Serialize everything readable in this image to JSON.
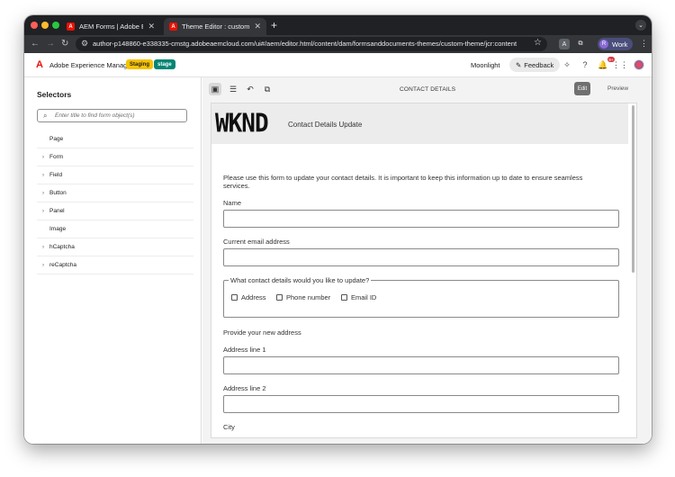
{
  "browser": {
    "tabs": [
      {
        "title": "AEM Forms | Adobe Experience",
        "favicon": "A",
        "active": false
      },
      {
        "title": "Theme Editor : custom-theme",
        "favicon": "A",
        "active": true
      }
    ],
    "new_tab": "+",
    "tab_menu": "⌄",
    "url": "author-p148860-e338335-cmstg.adobeaemcloud.com/ui#/aem/editor.html/content/dam/formsanddocuments-themes/custom-theme/jcr:content",
    "profile_label": "Work",
    "profile_initial": "R",
    "extension_1": "A",
    "traffic_colors": [
      "#ff5f57",
      "#febc2e",
      "#28c840"
    ]
  },
  "app_header": {
    "app_name": "Adobe Experience Manager",
    "badge_staging": "Staging",
    "badge_stage": "stage",
    "theme_label": "Moonlight",
    "feedback_label": "Feedback",
    "notification_count": "9+",
    "accent_color": "#eb1000"
  },
  "sidebar": {
    "title": "Selectors",
    "search_placeholder": "Enter title to find form object(s)",
    "items": [
      {
        "label": "Page",
        "expandable": false
      },
      {
        "label": "Form",
        "expandable": true
      },
      {
        "label": "Field",
        "expandable": true
      },
      {
        "label": "Button",
        "expandable": true
      },
      {
        "label": "Panel",
        "expandable": true
      },
      {
        "label": "Image",
        "expandable": false
      },
      {
        "label": "hCaptcha",
        "expandable": true
      },
      {
        "label": "reCaptcha",
        "expandable": true
      }
    ]
  },
  "editor": {
    "section_title": "CONTACT DETAILS",
    "edit_label": "Edit",
    "preview_label": "Preview"
  },
  "form": {
    "logo_text": "WKND",
    "banner_title": "Contact Details Update",
    "intro_line1": "Please use this form to update your contact details. It is important to keep this information up to date to ensure seamless",
    "intro_line2": "services.",
    "name_label": "Name",
    "email_label": "Current email address",
    "update_legend": "What contact details would you like to update?",
    "options": [
      "Address",
      "Phone number",
      "Email ID"
    ],
    "new_address_heading": "Provide your new address",
    "address1_label": "Address line 1",
    "address2_label": "Address line 2",
    "city_label": "City"
  }
}
